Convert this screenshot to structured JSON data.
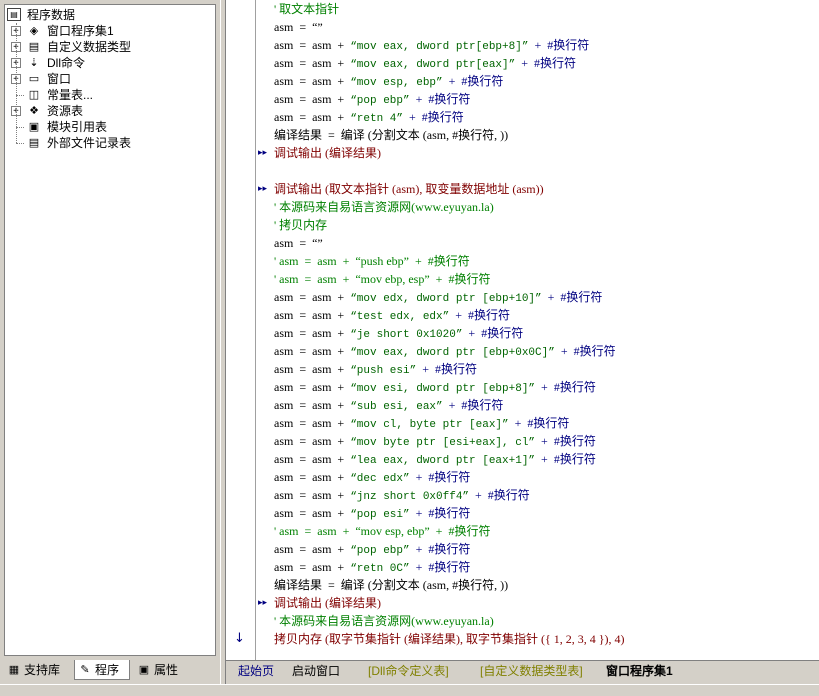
{
  "tree": {
    "root": "程序数据",
    "items": [
      {
        "label": "窗口程序集1",
        "icon": "layers-icon",
        "expandable": true
      },
      {
        "label": "自定义数据类型",
        "icon": "data-type-icon",
        "expandable": true
      },
      {
        "label": "Dll命令",
        "icon": "dll-icon",
        "expandable": true
      },
      {
        "label": "窗口",
        "icon": "window-icon",
        "expandable": true
      },
      {
        "label": "常量表...",
        "icon": "constants-icon",
        "expandable": false
      },
      {
        "label": "资源表",
        "icon": "resources-icon",
        "expandable": true
      },
      {
        "label": "模块引用表",
        "icon": "module-icon",
        "expandable": false
      },
      {
        "label": "外部文件记录表",
        "icon": "file-record-icon",
        "expandable": false
      }
    ]
  },
  "left_tabs": [
    "支持库",
    "程序",
    "属性"
  ],
  "code_lines": [
    {
      "t": "comment",
      "text": "' 取文本指针"
    },
    {
      "t": "plain",
      "text": "asm  =  “”"
    },
    {
      "t": "asm",
      "pre": "asm  =  asm  +  ",
      "str": "“mov eax, dword ptr[ebp+8]”",
      "post": "  +  #换行符"
    },
    {
      "t": "asm",
      "pre": "asm  =  asm  +  ",
      "str": "“mov eax, dword ptr[eax]”",
      "post": "  +  #换行符"
    },
    {
      "t": "asm",
      "pre": "asm  =  asm  +  ",
      "str": "“mov esp, ebp”",
      "post": "  +  #换行符"
    },
    {
      "t": "asm",
      "pre": "asm  =  asm  +  ",
      "str": "“pop ebp”",
      "post": "  +  #换行符"
    },
    {
      "t": "asm",
      "pre": "asm  =  asm  +  ",
      "str": "“retn 4”",
      "post": "  +  #换行符"
    },
    {
      "t": "compile",
      "text": "编译结果  =  编译 (分割文本 (asm, #换行符, ))"
    },
    {
      "t": "call",
      "text": "调试输出 (编译结果)",
      "arrow": "▸▸"
    },
    {
      "t": "blank",
      "text": ""
    },
    {
      "t": "call",
      "text": "调试输出 (取文本指针 (asm), 取变量数据地址 (asm))",
      "arrow": "▸▸"
    },
    {
      "t": "comment",
      "text": "' 本源码来自易语言资源网(www.eyuyan.la)"
    },
    {
      "t": "comment",
      "text": "' 拷贝内存"
    },
    {
      "t": "plain",
      "text": "asm  =  “”"
    },
    {
      "t": "casm",
      "pre": "' asm  =  asm  +  ",
      "str": "“push ebp”",
      "post": "  +  #换行符"
    },
    {
      "t": "casm",
      "pre": "' asm  =  asm  +  ",
      "str": "“mov ebp, esp”",
      "post": "  +  #换行符"
    },
    {
      "t": "asm",
      "pre": "asm  =  asm  +  ",
      "str": "“mov edx, dword ptr [ebp+10]”",
      "post": "  +  #换行符"
    },
    {
      "t": "asm",
      "pre": "asm  =  asm  +  ",
      "str": "“test edx, edx”",
      "post": "  +  #换行符"
    },
    {
      "t": "asm",
      "pre": "asm  =  asm  +  ",
      "str": "“je short 0x1020”",
      "post": "  +  #换行符"
    },
    {
      "t": "asm",
      "pre": "asm  =  asm  +  ",
      "str": "“mov eax, dword ptr [ebp+0x0C]”",
      "post": "  +  #换行符"
    },
    {
      "t": "asm",
      "pre": "asm  =  asm  +  ",
      "str": "“push esi”",
      "post": "  +  #换行符"
    },
    {
      "t": "asm",
      "pre": "asm  =  asm  +  ",
      "str": "“mov esi, dword ptr [ebp+8]”",
      "post": "  +  #换行符"
    },
    {
      "t": "asm",
      "pre": "asm  =  asm  +  ",
      "str": "“sub esi, eax”",
      "post": "  +  #换行符"
    },
    {
      "t": "asm",
      "pre": "asm  =  asm  +  ",
      "str": "“mov cl, byte ptr [eax]”",
      "post": "  +  #换行符"
    },
    {
      "t": "asm",
      "pre": "asm  =  asm  +  ",
      "str": "“mov byte ptr [esi+eax], cl”",
      "post": "  +  #换行符"
    },
    {
      "t": "asm",
      "pre": "asm  =  asm  +  ",
      "str": "“lea eax, dword ptr [eax+1]”",
      "post": "  +  #换行符"
    },
    {
      "t": "asm",
      "pre": "asm  =  asm  +  ",
      "str": "“dec edx”",
      "post": "  +  #换行符"
    },
    {
      "t": "asm",
      "pre": "asm  =  asm  +  ",
      "str": "“jnz short 0x0ff4”",
      "post": "  +  #换行符"
    },
    {
      "t": "asm",
      "pre": "asm  =  asm  +  ",
      "str": "“pop esi”",
      "post": "  +  #换行符"
    },
    {
      "t": "casm",
      "pre": "' asm  =  asm  +  ",
      "str": "“mov esp, ebp”",
      "post": "  +  #换行符"
    },
    {
      "t": "asm",
      "pre": "asm  =  asm  +  ",
      "str": "“pop ebp”",
      "post": "  +  #换行符"
    },
    {
      "t": "asm",
      "pre": "asm  =  asm  +  ",
      "str": "“retn 0C”",
      "post": "  +  #换行符"
    },
    {
      "t": "compile",
      "text": "编译结果  =  编译 (分割文本 (asm, #换行符, ))"
    },
    {
      "t": "call",
      "text": "调试输出 (编译结果)",
      "arrow": "▸▸"
    },
    {
      "t": "comment",
      "text": "' 本源码来自易语言资源网(www.eyuyan.la)"
    },
    {
      "t": "copy",
      "text": "拷贝内存 (取字节集指针 (编译结果), 取字节集指针 ({ 1, 2, 3, 4 }), 4)",
      "arrow": "↓"
    }
  ],
  "bottom_tabs": [
    "起始页",
    "启动窗口",
    "[Dll命令定义表]",
    "[自定义数据类型表]",
    "窗口程序集1"
  ],
  "colors": {
    "comment": "#008000",
    "string": "#006400",
    "call": "#800000",
    "keyword": "#000080"
  }
}
